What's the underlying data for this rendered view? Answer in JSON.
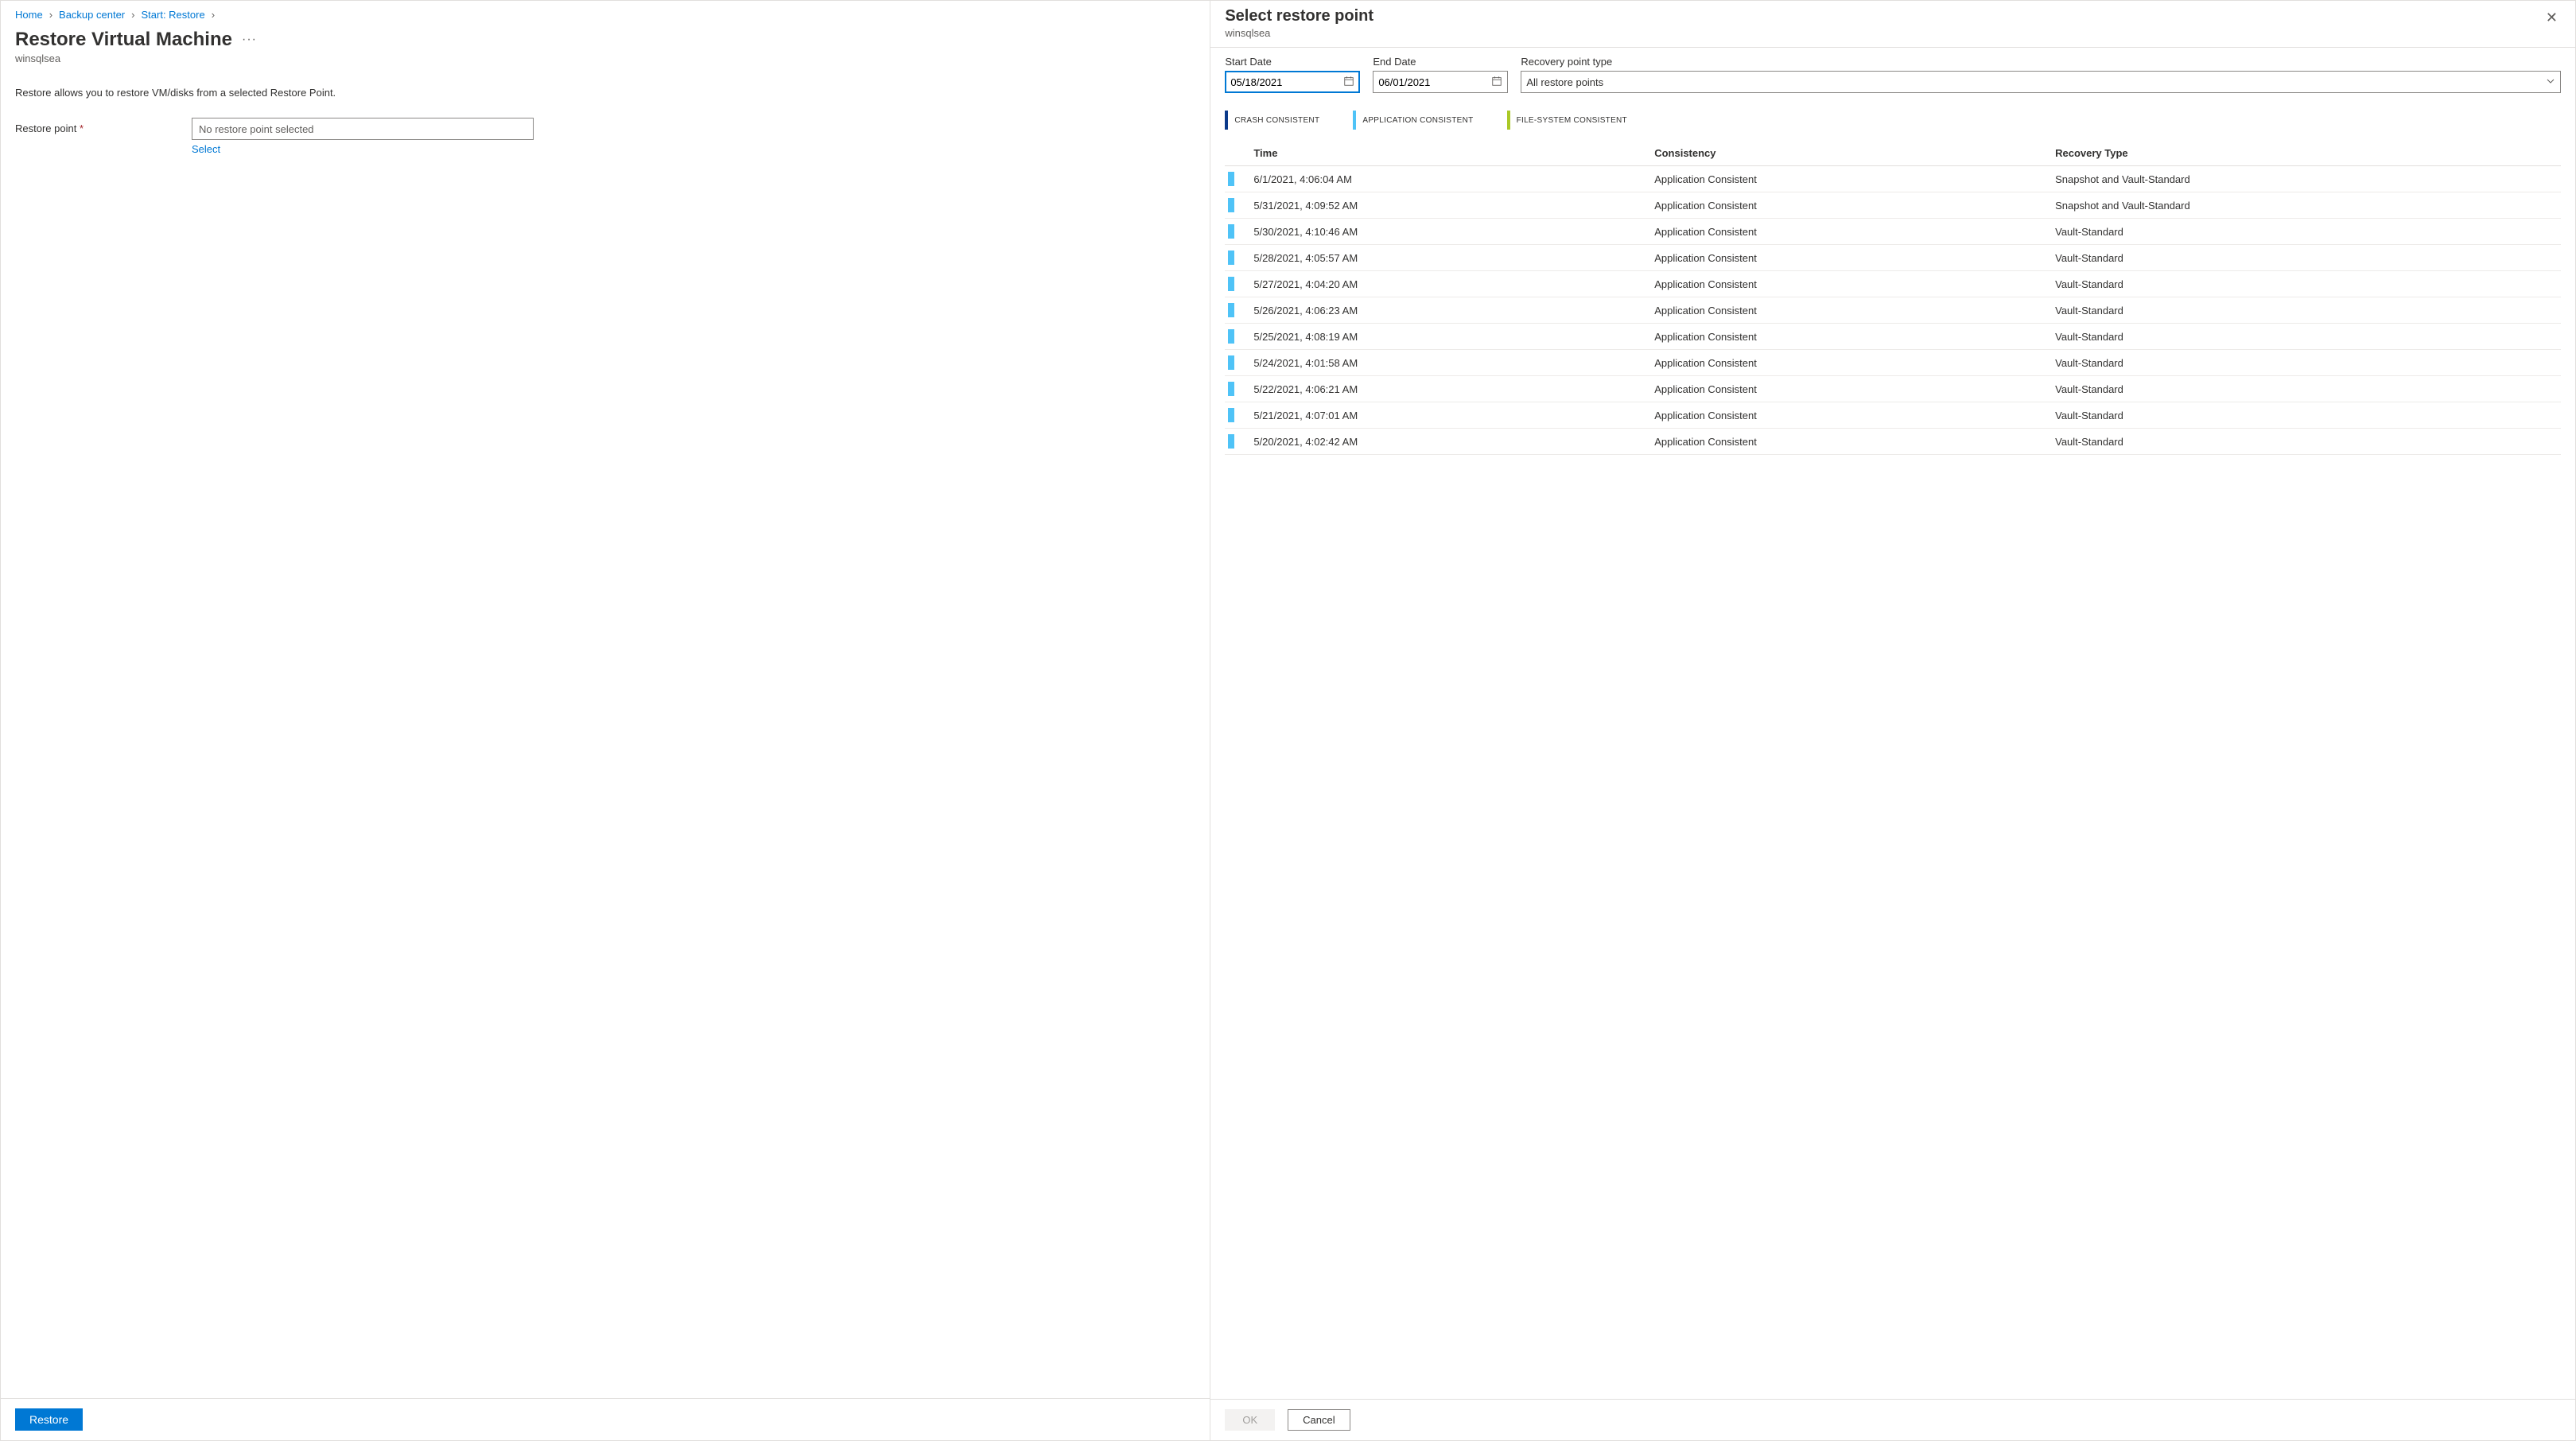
{
  "breadcrumb": {
    "home": "Home",
    "center": "Backup center",
    "start": "Start: Restore"
  },
  "left": {
    "title": "Restore Virtual Machine",
    "subtitle": "winsqlsea",
    "intro": "Restore allows you to restore VM/disks from a selected Restore Point.",
    "rp_label": "Restore point",
    "rp_placeholder": "No restore point selected",
    "select_link": "Select",
    "restore_btn": "Restore"
  },
  "panel": {
    "title": "Select restore point",
    "subtitle": "winsqlsea",
    "start_label": "Start Date",
    "start_value": "05/18/2021",
    "end_label": "End Date",
    "end_value": "06/01/2021",
    "type_label": "Recovery point type",
    "type_value": "All restore points",
    "legend": {
      "crash": "CRASH CONSISTENT",
      "app": "APPLICATION CONSISTENT",
      "fs": "FILE-SYSTEM CONSISTENT"
    },
    "cols": {
      "time": "Time",
      "consistency": "Consistency",
      "recovery": "Recovery Type"
    },
    "rows": [
      {
        "time": "6/1/2021, 4:06:04 AM",
        "consistency": "Application Consistent",
        "recovery": "Snapshot and Vault-Standard"
      },
      {
        "time": "5/31/2021, 4:09:52 AM",
        "consistency": "Application Consistent",
        "recovery": "Snapshot and Vault-Standard"
      },
      {
        "time": "5/30/2021, 4:10:46 AM",
        "consistency": "Application Consistent",
        "recovery": "Vault-Standard"
      },
      {
        "time": "5/28/2021, 4:05:57 AM",
        "consistency": "Application Consistent",
        "recovery": "Vault-Standard"
      },
      {
        "time": "5/27/2021, 4:04:20 AM",
        "consistency": "Application Consistent",
        "recovery": "Vault-Standard"
      },
      {
        "time": "5/26/2021, 4:06:23 AM",
        "consistency": "Application Consistent",
        "recovery": "Vault-Standard"
      },
      {
        "time": "5/25/2021, 4:08:19 AM",
        "consistency": "Application Consistent",
        "recovery": "Vault-Standard"
      },
      {
        "time": "5/24/2021, 4:01:58 AM",
        "consistency": "Application Consistent",
        "recovery": "Vault-Standard"
      },
      {
        "time": "5/22/2021, 4:06:21 AM",
        "consistency": "Application Consistent",
        "recovery": "Vault-Standard"
      },
      {
        "time": "5/21/2021, 4:07:01 AM",
        "consistency": "Application Consistent",
        "recovery": "Vault-Standard"
      },
      {
        "time": "5/20/2021, 4:02:42 AM",
        "consistency": "Application Consistent",
        "recovery": "Vault-Standard"
      }
    ],
    "ok_btn": "OK",
    "cancel_btn": "Cancel"
  }
}
